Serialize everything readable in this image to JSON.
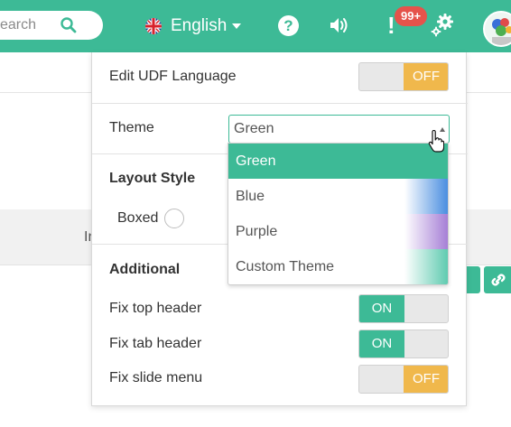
{
  "header": {
    "search_placeholder": "earch",
    "language": {
      "label": "English"
    },
    "notifications": {
      "badge": "99+"
    },
    "colors": {
      "bar": "#3dba96"
    }
  },
  "background": {
    "partial_text": "In"
  },
  "settings": {
    "edit_udf_language": {
      "label": "Edit UDF Language",
      "state": "OFF"
    },
    "theme": {
      "label": "Theme",
      "selected": "Green",
      "options": [
        {
          "label": "Green",
          "color": "#3dba96"
        },
        {
          "label": "Blue",
          "color": "#4a8ee0"
        },
        {
          "label": "Purple",
          "color": "#a67fd6"
        },
        {
          "label": "Custom Theme",
          "color": "#5fcbb0"
        }
      ]
    },
    "layout_style": {
      "title": "Layout Style",
      "boxed_label": "Boxed"
    },
    "additional": {
      "title": "Additional",
      "fix_top_header": {
        "label": "Fix top header",
        "state": "ON"
      },
      "fix_tab_header": {
        "label": "Fix tab header",
        "state": "ON"
      },
      "fix_slide_menu": {
        "label": "Fix slide menu",
        "state": "OFF"
      }
    }
  },
  "icons": [
    "search-icon",
    "uk-flag-icon",
    "chevron-down-icon",
    "help-icon",
    "sound-icon",
    "alert-icon",
    "gear-icon",
    "avatar",
    "link-icon",
    "cursor-icon"
  ]
}
